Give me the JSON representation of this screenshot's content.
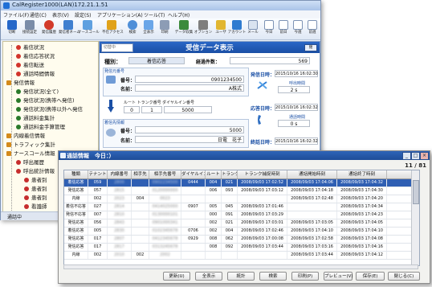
{
  "back_window": {
    "title": "CalRegister1000(LAN)172.21.1.51",
    "menu": [
      "ファイル(F)",
      "通信(C)",
      "表示(V)",
      "設定(S)",
      "アプリケーション(A)",
      "ツール(T)",
      "ヘルプ(H)"
    ],
    "toolbar": [
      "切断",
      "接続設定",
      "発信履歴",
      "発信者ネーム",
      "ナースコール",
      "不在アクセス",
      "検索",
      "全表示",
      "印刷",
      "データ収集",
      "オプション",
      "ユーザ",
      "アカウント",
      "メール",
      "今日",
      "前日",
      "今週",
      "前週"
    ],
    "tree": [
      {
        "label": "着信状況",
        "icon_color": "#d2352b"
      },
      {
        "label": "着信応答状況",
        "icon_color": "#d2352b"
      },
      {
        "label": "着信転送",
        "icon_color": "#d2352b"
      },
      {
        "label": "通話時間情報",
        "icon_color": "#d2352b"
      },
      {
        "label": "発信情報",
        "icon_color": "#d48a1a"
      },
      {
        "label": "発信状況(全て)",
        "icon_color": "#2a7a2a"
      },
      {
        "label": "発信状況(携帯へ発信)",
        "icon_color": "#2a7a2a"
      },
      {
        "label": "発信状況(携帯以外へ発信",
        "icon_color": "#2a7a2a"
      },
      {
        "label": "通話料金集計",
        "icon_color": "#2a7a2a"
      },
      {
        "label": "通話料金手算管理",
        "icon_color": "#2a7a2a"
      },
      {
        "label": "内線着信情報",
        "icon_color": "#d48a1a"
      },
      {
        "label": "トラフィック集計",
        "icon_color": "#d48a1a"
      },
      {
        "label": "ナースコール情報",
        "icon_color": "#d48a1a"
      },
      {
        "label": "呼出履歴",
        "icon_color": "#c62d2d"
      },
      {
        "label": "呼出統計情報",
        "icon_color": "#c62d2d"
      },
      {
        "label": "患者別",
        "icon_color": "#c62d2d"
      },
      {
        "label": "患者別",
        "icon_color": "#c62d2d"
      },
      {
        "label": "患者別",
        "icon_color": "#c62d2d"
      },
      {
        "label": "看護師",
        "icon_color": "#c62d2d"
      }
    ],
    "status": "通話中",
    "detail": {
      "select_value": "切替中",
      "title": "受信データ表示",
      "close_label": "閉",
      "kind_label": "種別：",
      "kind_value": "着信応答",
      "total_label": "経過件数：",
      "total_value": "569",
      "caller_section": "発信元番号",
      "caller_number_label": "番号：",
      "caller_number_value": "0901234500",
      "caller_name_label": "名前：",
      "caller_name_value": "A株式",
      "route_headers": "ルート トランク番号 ダイヤルイン番号",
      "route_values": [
        "0",
        "1",
        "5000"
      ],
      "dest_section": "着信先情報",
      "dest_number_label": "番号：",
      "dest_number_value": "5000",
      "dest_name_label": "名前：",
      "dest_name_value": "日電　花子",
      "call_time_label": "発信日時：",
      "call_time_value": "2015/10/16 16:02:30",
      "ring_label": "呼出時間",
      "ring_value": "2 s",
      "answer_time_label": "応答日時：",
      "answer_time_value": "2015/10/16 16:02:32",
      "talk_label": "通話時間",
      "talk_value": "0 s",
      "end_time_label": "終話日時：",
      "end_time_value": "2015/10/16 16:02:32"
    }
  },
  "front_window": {
    "title": "通話情報　今日：）",
    "pager": "11 / 81",
    "columns": [
      "種類",
      "テナント",
      "内線番号",
      "相手先",
      "相手先番号",
      "ダイヤルイン",
      "ルート",
      "トランク",
      "トランク捕捉時刻",
      "通話開始時刻",
      "通話終了時刻"
    ],
    "rows": [
      [
        "着信応答",
        "059",
        "2800",
        "",
        "0902234500",
        "0444",
        "004",
        "021",
        "2008/09/03 17:02:52",
        "2008/09/03 17:04:06",
        "2008/09/03 17:04:32"
      ],
      [
        "発信応答",
        "057",
        "2815",
        "",
        "0120000000",
        "",
        "006",
        "093",
        "2008/09/03 17:03:12",
        "2008/09/03 17:04:18",
        "2008/09/03 17:04:30"
      ],
      [
        "内線",
        "002",
        "2023",
        "004",
        "0023",
        "",
        "",
        "",
        "",
        "2008/09/03 17:02:48",
        "2008/09/03 17:04:20"
      ],
      [
        "着信不応答",
        "027",
        "2814",
        "",
        "0414025000",
        "0907",
        "005",
        "045",
        "2008/09/03 17:01:46",
        "",
        "2008/09/03 17:04:34"
      ],
      [
        "発信不応答",
        "007",
        "2810",
        "",
        "0130000101",
        "",
        "000",
        "091",
        "2008/09/03 17:03:29",
        "",
        "2008/09/03 17:04:23"
      ],
      [
        "発信応答",
        "056",
        "2843",
        "",
        "0901000341",
        "",
        "002",
        "021",
        "2008/09/03 17:03:01",
        "2008/09/03 17:03:05",
        "2008/09/03 17:04:05"
      ],
      [
        "着信応答",
        "005",
        "2830",
        "",
        "0102345678",
        "0706",
        "002",
        "004",
        "2008/09/03 17:02:46",
        "2008/09/03 17:04:10",
        "2008/09/03 17:04:10"
      ],
      [
        "発信応答",
        "017",
        "2807",
        "",
        "0412345678",
        "0929",
        "008",
        "062",
        "2008/09/03 17:00:08",
        "2008/09/03 17:02:58",
        "2008/09/03 17:04:08"
      ],
      [
        "発信応答",
        "017",
        "2817",
        "",
        "0313245678",
        "",
        "008",
        "092",
        "2008/09/03 17:03:44",
        "2008/09/03 17:03:16",
        "2008/09/03 17:04:16"
      ],
      [
        "内線",
        "002",
        "2010",
        "002",
        "2002",
        "",
        "",
        "",
        "",
        "2008/09/03 17:03:44",
        "2008/09/03 17:04:12"
      ]
    ],
    "buttons": [
      "更新(U)",
      "全表示",
      "統計",
      "検索",
      "印刷(P)",
      "プレビュー(V)",
      "保存(E)",
      "閉じる(C)"
    ]
  }
}
